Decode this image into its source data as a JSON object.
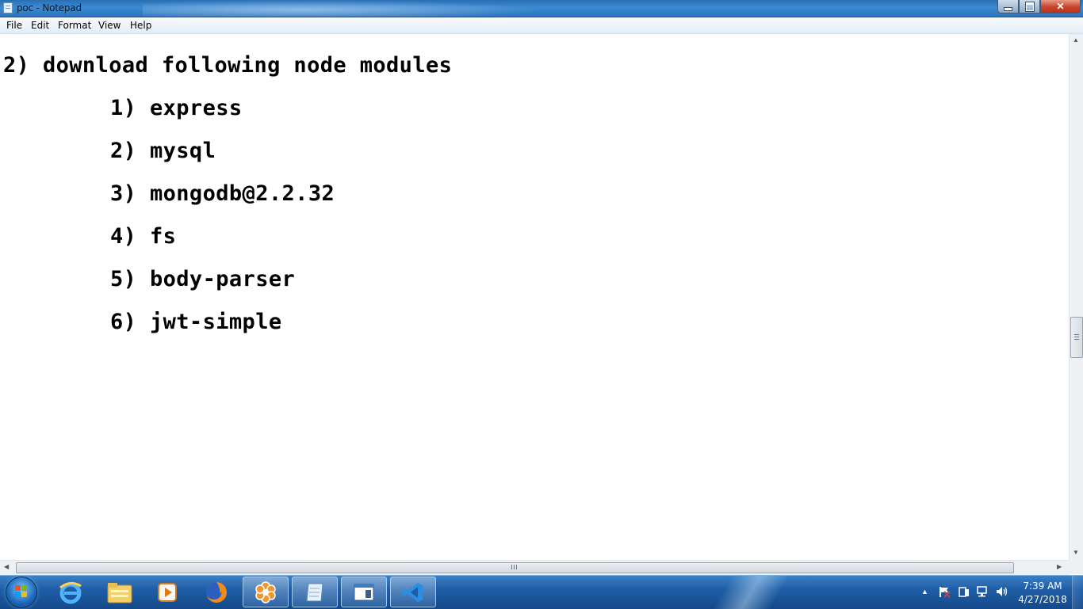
{
  "window": {
    "title": "poc - Notepad",
    "close_glyph": "✕"
  },
  "menu": {
    "items": [
      "File",
      "Edit",
      "Format",
      "View",
      "Help"
    ]
  },
  "editor": {
    "lines": [
      "2) download following node modules",
      "1) express",
      "2) mysql",
      "3) mongodb@2.2.32",
      "4) fs",
      "5) body-parser",
      "6) jwt-simple"
    ]
  },
  "taskbar": {
    "apps": [
      {
        "name": "internet-explorer-icon"
      },
      {
        "name": "file-explorer-icon"
      },
      {
        "name": "media-player-icon"
      },
      {
        "name": "firefox-icon"
      },
      {
        "name": "app-flower-icon"
      },
      {
        "name": "notepad-icon"
      },
      {
        "name": "window-app-icon"
      },
      {
        "name": "vscode-icon"
      }
    ],
    "tray_arrow": "▲",
    "clock": {
      "time": "7:39 AM",
      "date": "4/27/2018"
    }
  },
  "colors": {
    "titlebar": "#2e74bb",
    "taskbar": "#1f5ea7",
    "close_button": "#c8442c"
  }
}
